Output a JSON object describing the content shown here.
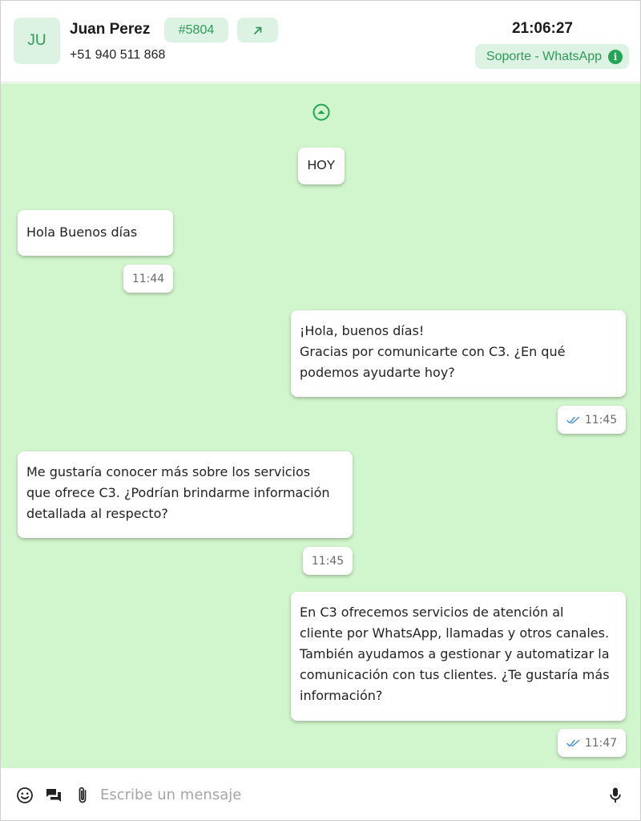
{
  "header": {
    "avatar_initials": "JU",
    "contact_name": "Juan Perez",
    "ticket_id": "#5804",
    "contact_phone": "+51 940 511 868",
    "clock": "21:06:27",
    "channel": "Soporte - WhatsApp",
    "info_symbol": "i"
  },
  "chat": {
    "date_divider": "HOY",
    "messages": [
      {
        "direction": "incoming",
        "lines": [
          "Hola Buenos días"
        ],
        "time": "11:44"
      },
      {
        "direction": "outgoing",
        "lines": [
          "¡Hola, buenos días!",
          "Gracias por comunicarte con C3. ¿En qué",
          "podemos ayudarte hoy?"
        ],
        "time": "11:45",
        "status": "read"
      },
      {
        "direction": "incoming",
        "lines": [
          "Me gustaría conocer más sobre los servicios",
          "que ofrece C3. ¿Podrían brindarme información",
          "detallada al respecto?"
        ],
        "time": "11:45"
      },
      {
        "direction": "outgoing",
        "lines": [
          "En C3 ofrecemos servicios de atención al",
          "cliente por WhatsApp, llamadas y otros canales.",
          "También ayudamos a gestionar y automatizar la",
          "comunicación con tus clientes. ¿Te gustaría más",
          "información?"
        ],
        "time": "11:47",
        "status": "read"
      }
    ]
  },
  "composer": {
    "placeholder": "Escribe un mensaje",
    "value": ""
  },
  "icons": {
    "open": "arrow-up-right-icon",
    "info": "info-icon",
    "scroll": "chevron-up-circle-icon",
    "read": "double-check-icon",
    "emoji": "emoji-icon",
    "quick_replies": "chat-bubbles-icon",
    "attach": "paperclip-icon",
    "mic": "microphone-icon"
  },
  "colors": {
    "accent": "#2f9a57",
    "chip_bg": "#dcf3e4",
    "chat_bg": "#d1f5cc",
    "read_check": "#3d8fd8"
  }
}
